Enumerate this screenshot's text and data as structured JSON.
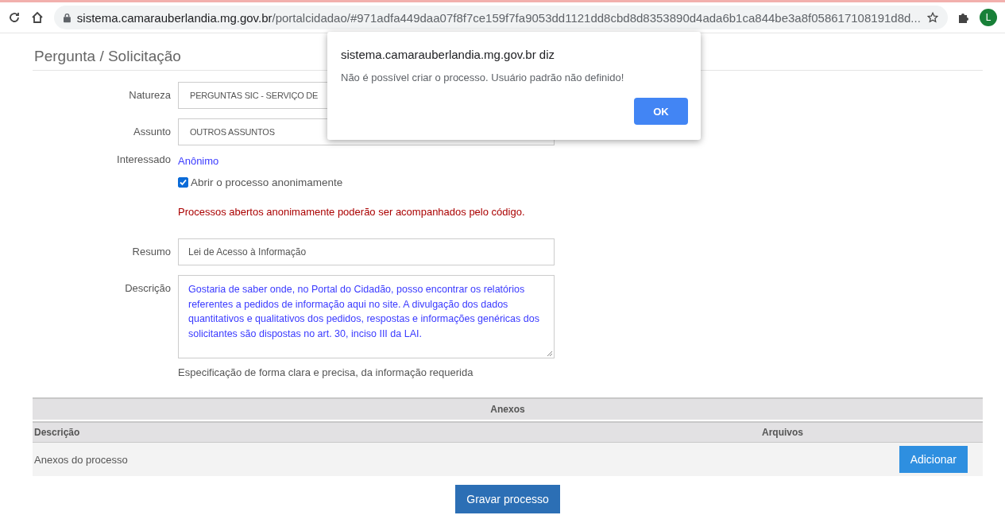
{
  "browser": {
    "url_host": "sistema.camarauberlandia.mg.gov.br",
    "url_path": "/portalcidadao/#971adfa449daa07f8f7ce159f7fa9053dd1121dd8cbd8d8353890d4ada6b1ca844be3a8f058617108191d8d...",
    "profile_initial": "L"
  },
  "heading": "Pergunta / Solicitação",
  "fields": [
    {
      "kind": "select",
      "label": "Natureza",
      "value": "PERGUNTAS SIC - SERVIÇO DE"
    },
    {
      "kind": "select",
      "label": "Assunto",
      "value": "OUTROS ASSUNTOS"
    },
    {
      "kind": "link",
      "label": "Interessado",
      "value": "Anônimo"
    },
    {
      "kind": "checkbox",
      "text": "Abrir o processo anonimamente",
      "checked": true
    },
    {
      "kind": "warning",
      "text": "Processos abertos anonimamente poderão ser acompanhados pelo código."
    },
    {
      "kind": "input",
      "label": "Resumo",
      "value": "Lei de Acesso à Informação"
    },
    {
      "kind": "textarea",
      "label": "Descrição",
      "value": "Gostaria de saber onde, no Portal do Cidadão, posso encontrar os relatórios referentes a pedidos de informação aqui no site. A divulgação dos dados quantitativos e qualitativos dos pedidos, respostas e informações genéricas dos solicitantes são dispostas no art. 30, inciso III da LAI."
    },
    {
      "kind": "help",
      "text": "Especificação de forma clara e precisa, da informação requerida"
    }
  ],
  "attachments": {
    "title": "Anexos",
    "columns": [
      "Descrição",
      "Arquivos"
    ],
    "rows": [
      {
        "description": "Anexos do processo",
        "button": "Adicionar"
      }
    ]
  },
  "save_button": "Gravar processo",
  "dialog": {
    "title": "sistema.camarauberlandia.mg.gov.br diz",
    "message": "Não é possível criar o processo. Usuário padrão não definido!",
    "button": "OK"
  }
}
